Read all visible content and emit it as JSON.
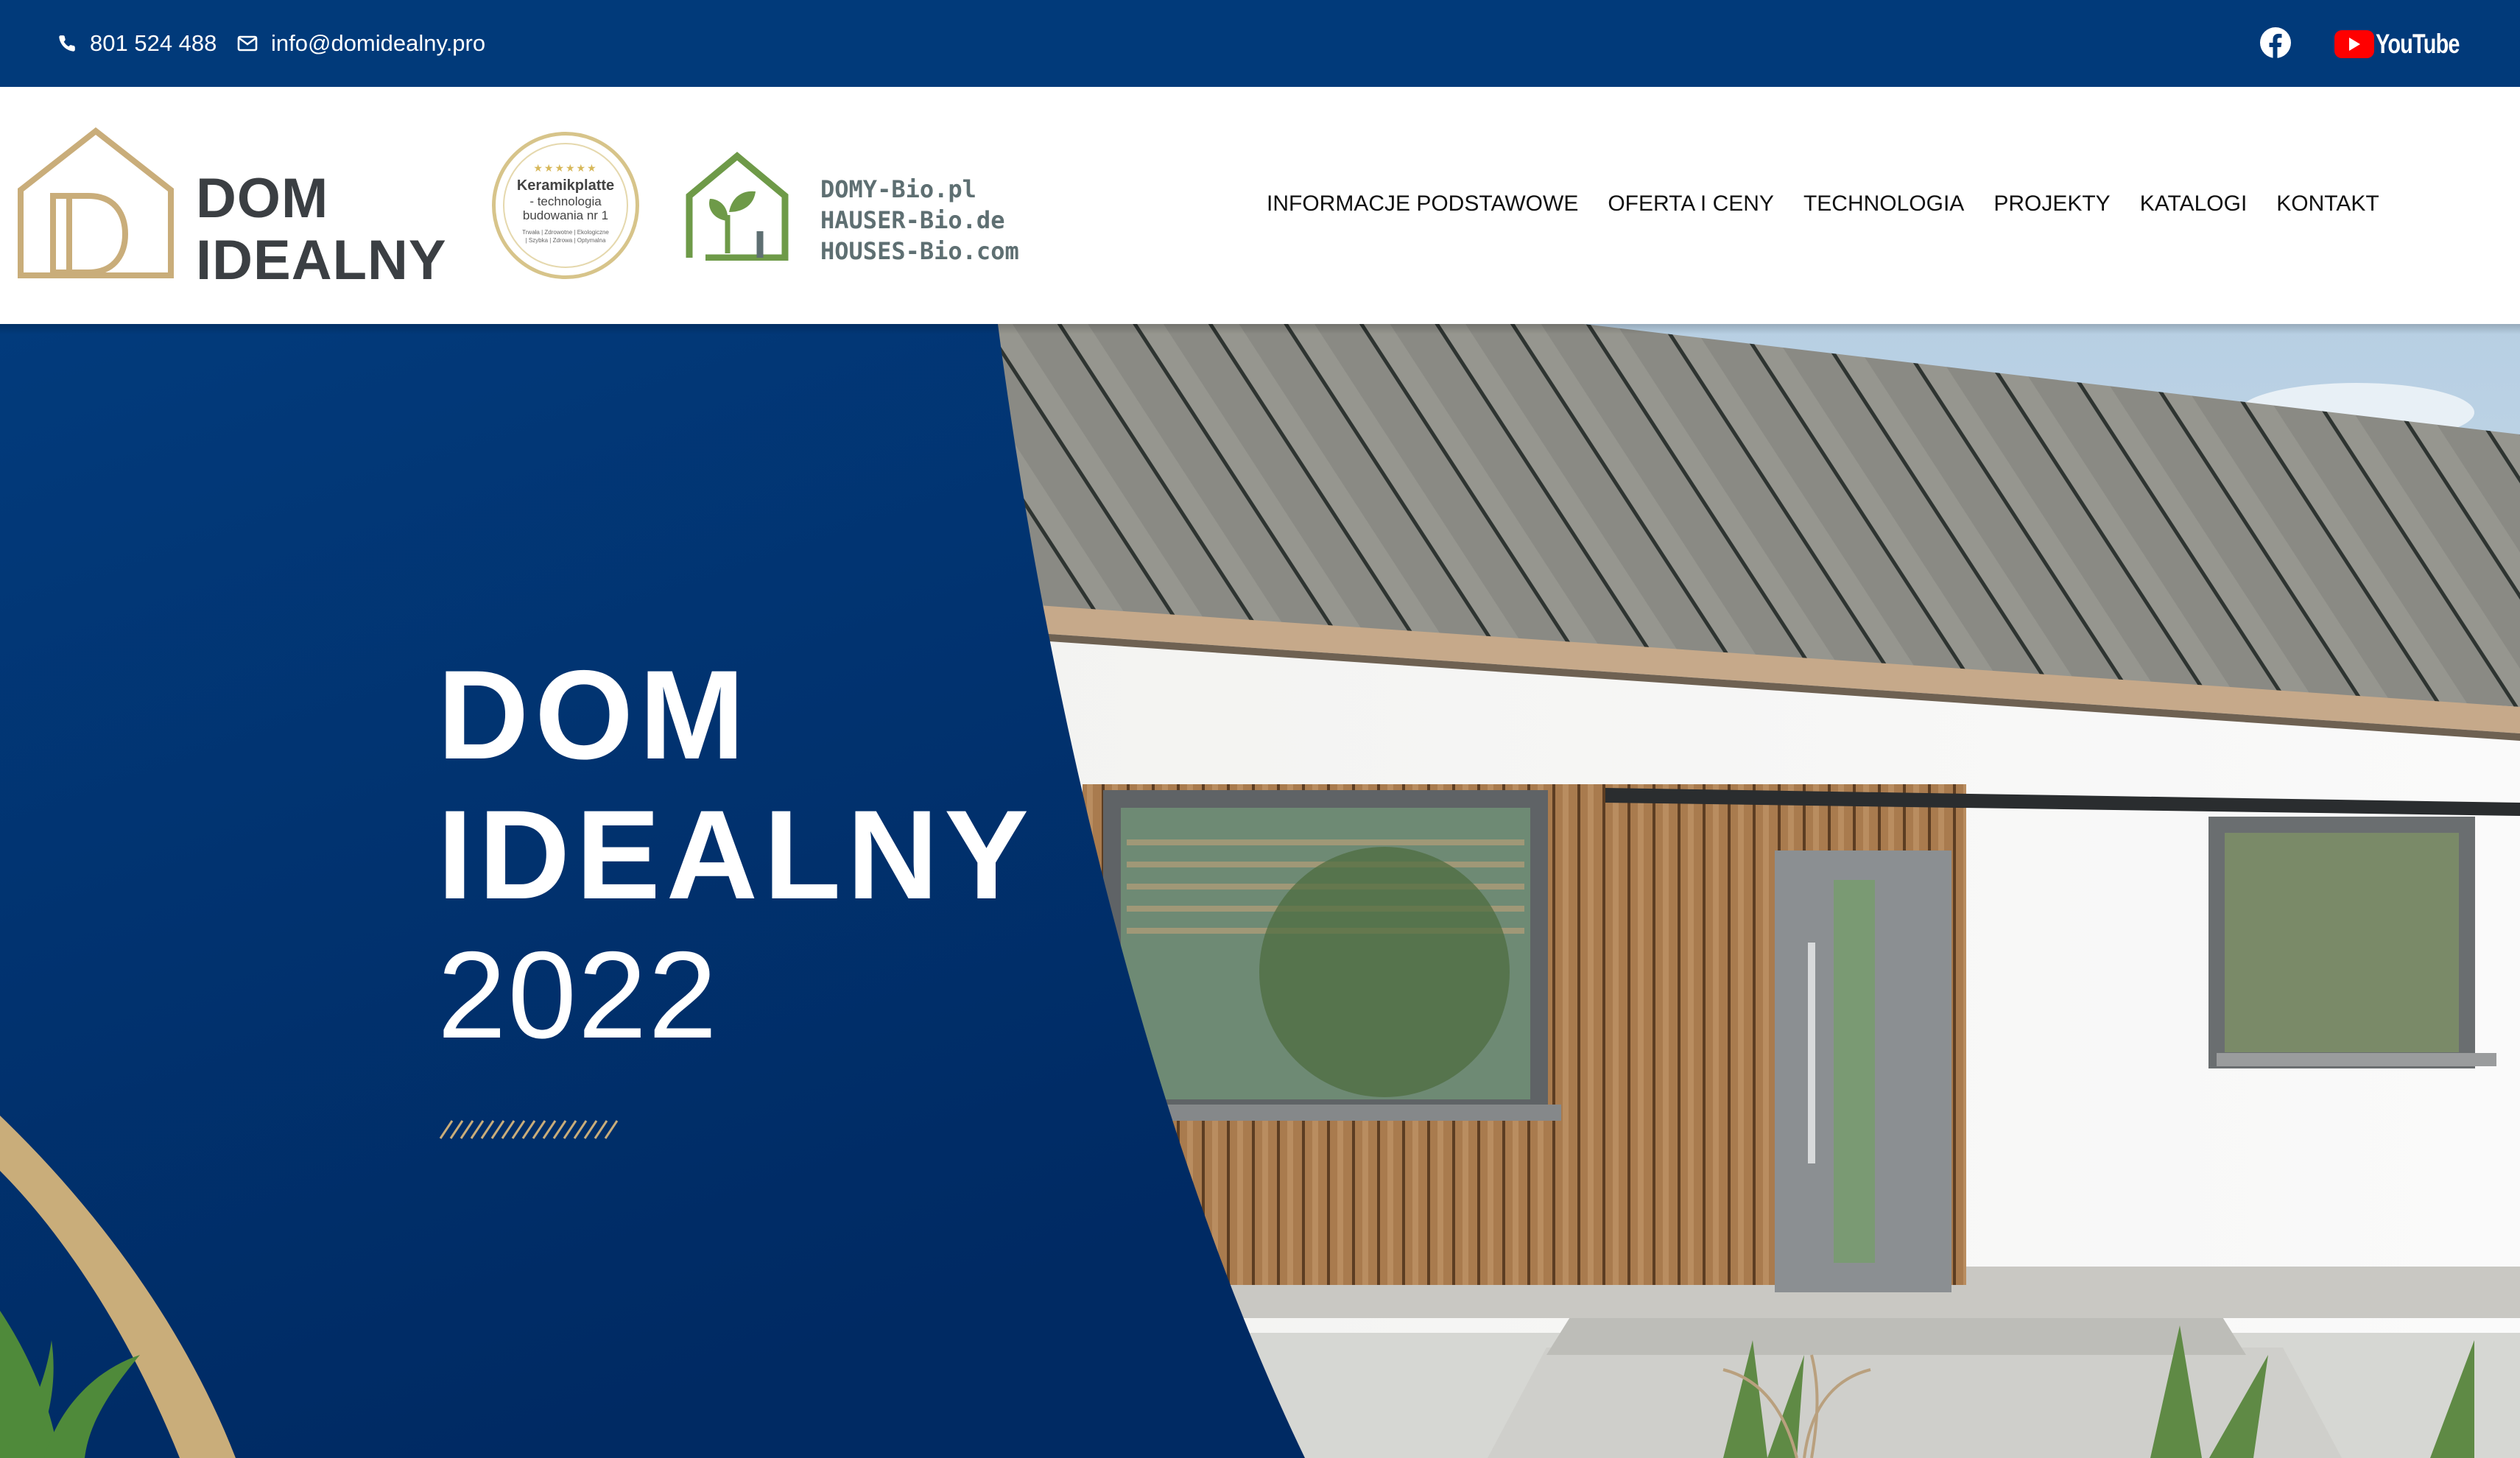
{
  "topbar": {
    "phone": "801 524 488",
    "email": "info@domidealny.pro",
    "social": [
      {
        "icon": "facebook-icon"
      },
      {
        "icon": "youtube-logo",
        "label": "YouTube"
      }
    ]
  },
  "header": {
    "logo_text_line1": "DOM",
    "logo_text_line2": "IDEALNY",
    "badge": {
      "title": "Keramikplatte",
      "sub1": "- technologia",
      "sub2": "budowania nr 1",
      "small": "Trwała | Zdrowotne | Ekologiczne | Szybka | Zdrowa | Optymalna"
    },
    "bio_lines": [
      "DOMY-Bio.pl",
      "HAUSER-Bio.de",
      "HOUSES-Bio.com"
    ],
    "nav": [
      "INFORMACJE PODSTAWOWE",
      "OFERTA I CENY",
      "TECHNOLOGIA",
      "PROJEKTY",
      "KATALOGI",
      "KONTAKT"
    ]
  },
  "hero": {
    "line1": "DOM",
    "line2": "IDEALNY",
    "line3": "2022"
  },
  "colors": {
    "topbar_bg": "#013a7a",
    "hero_blue": "#003477",
    "gold": "#c9ad7a",
    "logo_text": "#3b3f43",
    "bio_green": "#6e9a48"
  }
}
